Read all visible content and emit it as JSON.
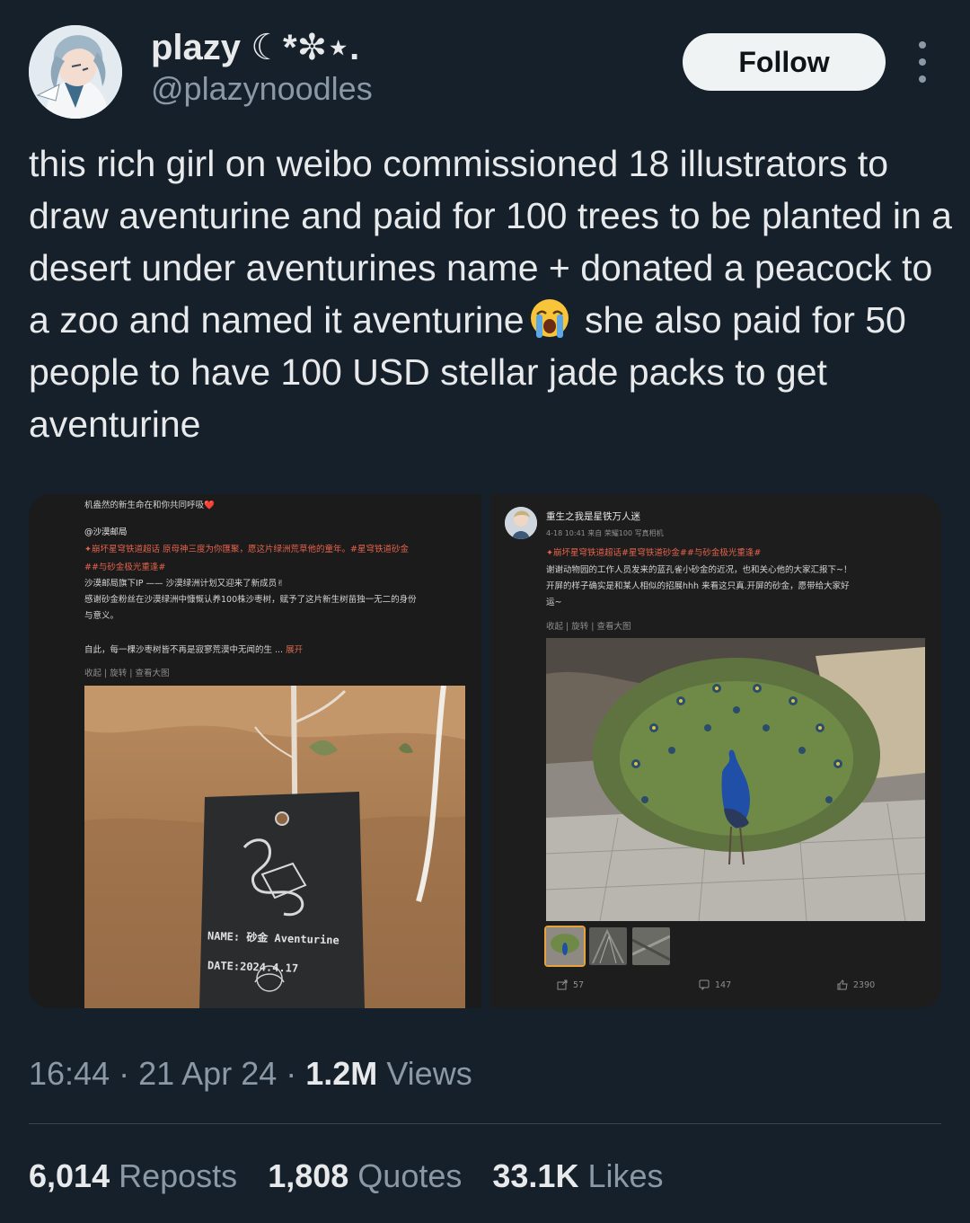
{
  "author": {
    "display_name": "plazy ☾*✼⋆.",
    "handle": "@plazynoodles",
    "follow_label": "Follow"
  },
  "tweet": {
    "text_before_emoji": "this rich girl on weibo commissioned 18 illustrators to draw aventurine and paid for 100 trees to be planted in a desert under aventurines name + donated a peacock to a zoo and named it aventurine",
    "text_after_emoji": " she also paid for 50 people to have 100 USD stellar jade packs to get aventurine",
    "emoji": "loudly-crying-face"
  },
  "left_screenshot": {
    "top_line": "机盎然的新生命在和你共同呼吸❤️",
    "account": "@沙漠邮局",
    "tag_line1": "✦崩坏星穹铁道超话 原母神三度为你匯聚，愿这片绿洲荒草他的童年。#星穹铁道砂金",
    "tag_line2": "##与砂金极光重逢#",
    "body_line1": "沙漠邮局旗下IP —— 沙漠绿洲计划又迎来了新成员✌",
    "body_line2": "感谢砂金粉丝在沙漠绿洲中慷慨认养100株沙枣树，赋予了这片新生树苗独一无二的身份",
    "body_line3": "与意义。",
    "body_line4": "自此，每一棵沙枣树皆不再是寂寥荒漠中无闻的生 ...",
    "expand": "展开",
    "actions": "收起  |  旋转  |  查看大图",
    "tag_title": "砂金",
    "tag_name": "NAME: 砂金 Aventurine",
    "tag_date": "DATE:2024.4.17"
  },
  "right_screenshot": {
    "user": "重生之我是星铁万人迷",
    "meta": "4-18 10:41  来自 荣耀100 写真相机",
    "tag_line": "✦崩坏星穹铁道超话#星穹铁道砂金##与砂金极光重逢#",
    "body_line1": "谢谢动物园的工作人员发来的蓝孔雀小砂金的近况，也和关心他的大家汇报下~！",
    "body_line2": "开屏的样子确实是和某人相似的招展hhh 来看这只真.开屏的砂金，愿带给大家好",
    "body_line3": "运~",
    "actions": "收起  |  旋转  |  查看大图",
    "reposts": "57",
    "comments": "147",
    "likes": "2390"
  },
  "footer": {
    "time": "16:44",
    "date": "21 Apr 24",
    "views_count": "1.2M",
    "views_label": "Views",
    "reposts_count": "6,014",
    "reposts_label": "Reposts",
    "quotes_count": "1,808",
    "quotes_label": "Quotes",
    "likes_count": "33.1K",
    "likes_label": "Likes"
  },
  "colors": {
    "background": "#15202b",
    "text_primary": "#e7e9ea",
    "text_secondary": "#8b98a5",
    "follow_bg": "#eff3f4"
  }
}
